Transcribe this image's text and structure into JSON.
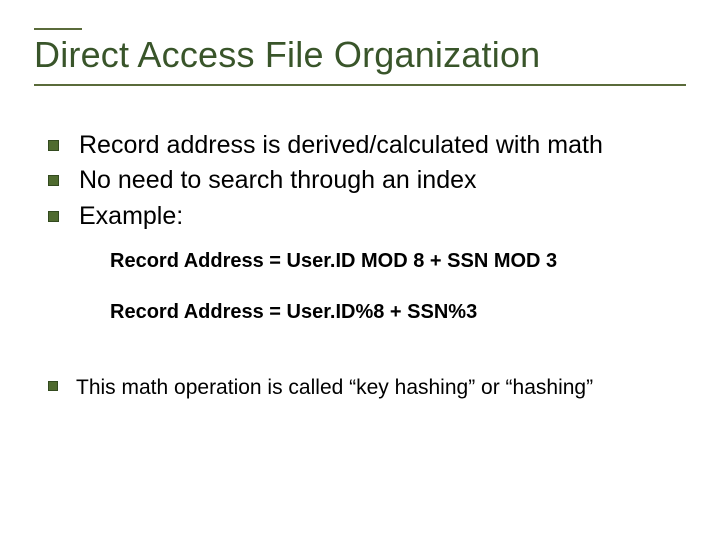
{
  "title": "Direct Access File Organization",
  "bullets": [
    "Record address is derived/calculated with math",
    "No need to search through an index",
    "Example:"
  ],
  "sub": [
    "Record Address = User.ID MOD 8 + SSN MOD 3",
    "Record Address = User.ID%8 + SSN%3"
  ],
  "footer_bullet": "This math operation is called “key hashing” or “hashing”"
}
